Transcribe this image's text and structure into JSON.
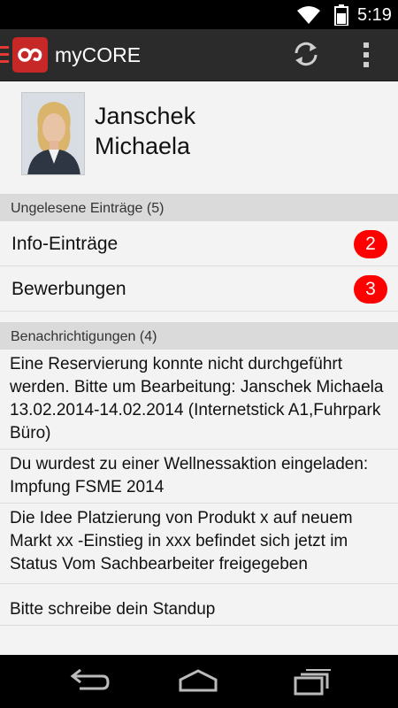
{
  "status_bar": {
    "time": "5:19",
    "icons": [
      "wifi-icon",
      "battery-icon"
    ]
  },
  "action_bar": {
    "app_title": "myCORE",
    "accent_color": "#c62828",
    "icons": [
      "menu-icon",
      "app-logo",
      "refresh-icon",
      "overflow-menu-icon"
    ]
  },
  "profile": {
    "last_name": "Janschek",
    "first_name": "Michaela"
  },
  "unread": {
    "header": "Ungelesene Einträge (5)",
    "items": [
      {
        "label": "Info-Einträge",
        "count": "2"
      },
      {
        "label": "Bewerbungen",
        "count": "3"
      }
    ],
    "badge_color": "#ff0000"
  },
  "notifications": {
    "header": "Benachrichtigungen (4)",
    "items": [
      {
        "text": "Eine Reservierung konnte nicht durchgeführt werden. Bitte um Bearbeitung: Janschek Michaela 13.02.2014-14.02.2014  (Internetstick A1,Fuhrpark Büro)"
      },
      {
        "text": "Du wurdest zu einer Wellnessaktion eingeladen: Impfung FSME 2014"
      },
      {
        "text": "Die Idee Platzierung von Produkt x auf neuem Markt xx -Einstieg in xxx befindet sich jetzt im Status Vom Sachbearbeiter freigegeben"
      },
      {
        "text": "Bitte schreibe dein Standup"
      }
    ]
  },
  "nav_bar": {
    "icons": [
      "back-icon",
      "home-icon",
      "recents-icon"
    ]
  }
}
